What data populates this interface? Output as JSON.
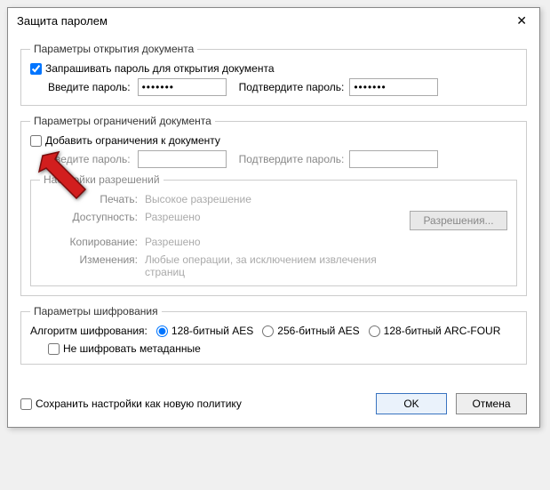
{
  "window": {
    "title": "Защита паролем"
  },
  "open_params": {
    "legend": "Параметры открытия документа",
    "request_password_label": "Запрашивать пароль для открытия документа",
    "enter_password_label": "Введите пароль:",
    "confirm_password_label": "Подтвердите пароль:",
    "password_value": "•••••••",
    "confirm_value": "•••••••"
  },
  "restrict_params": {
    "legend": "Параметры ограничений документа",
    "add_restrictions_label": "Добавить ограничения к документу",
    "enter_password_label": "Введите пароль:",
    "confirm_password_label": "Подтвердите пароль:",
    "permissions": {
      "legend": "Настройки разрешений",
      "print_label": "Печать:",
      "print_value": "Высокое разрешение",
      "access_label": "Доступность:",
      "access_value": "Разрешено",
      "copy_label": "Копирование:",
      "copy_value": "Разрешено",
      "changes_label": "Изменения:",
      "changes_value": "Любые операции, за исключением извлечения страниц",
      "button_label": "Разрешения..."
    }
  },
  "encryption": {
    "legend": "Параметры шифрования",
    "algo_label": "Алгоритм шифрования:",
    "opt_aes128": "128-битный AES",
    "opt_aes256": "256-битный AES",
    "opt_arcfour": "128-битный ARC-FOUR",
    "no_encrypt_meta_label": "Не шифровать метаданные"
  },
  "footer": {
    "save_policy_label": "Сохранить настройки как новую политику",
    "ok_label": "OK",
    "cancel_label": "Отмена"
  }
}
